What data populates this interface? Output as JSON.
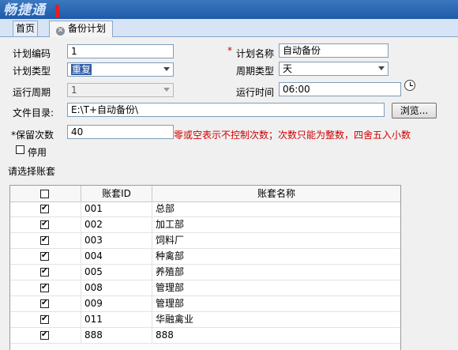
{
  "app": {
    "logo_text": "畅捷通"
  },
  "tabs": [
    {
      "label": "首页"
    },
    {
      "label": "备份计划"
    }
  ],
  "form": {
    "plan_code_label": "计划编码",
    "plan_code_value": "1",
    "plan_name_label": "计划名称",
    "plan_name_value": "自动备份",
    "plan_type_label": "计划类型",
    "plan_type_value": "重复",
    "period_type_label": "周期类型",
    "period_type_value": "天",
    "run_period_label": "运行周期",
    "run_period_value": "1",
    "run_time_label": "运行时间",
    "run_time_value": "06:00",
    "file_dir_label": "文件目录:",
    "file_dir_value": "E:\\T+自动备份\\",
    "browse_label": "浏览...",
    "keep_count_label": "保留次数",
    "keep_count_value": "40",
    "keep_note": "零或空表示不控制次数；次数只能为整数，四舍五入小数",
    "disable_label": "停用",
    "select_accounts_label": "请选择账套",
    "required_mark": "*"
  },
  "table": {
    "headers": {
      "id": "账套ID",
      "name": "账套名称"
    },
    "rows": [
      {
        "id": "001",
        "name": "总部",
        "checked": true
      },
      {
        "id": "002",
        "name": "加工部",
        "checked": true
      },
      {
        "id": "003",
        "name": "饲料厂",
        "checked": true
      },
      {
        "id": "004",
        "name": "种禽部",
        "checked": true
      },
      {
        "id": "005",
        "name": "养殖部",
        "checked": true
      },
      {
        "id": "008",
        "name": "管理部",
        "checked": true
      },
      {
        "id": "009",
        "name": "管理部",
        "checked": true
      },
      {
        "id": "011",
        "name": "华融禽业",
        "checked": true
      },
      {
        "id": "888",
        "name": "888",
        "checked": true
      }
    ]
  }
}
